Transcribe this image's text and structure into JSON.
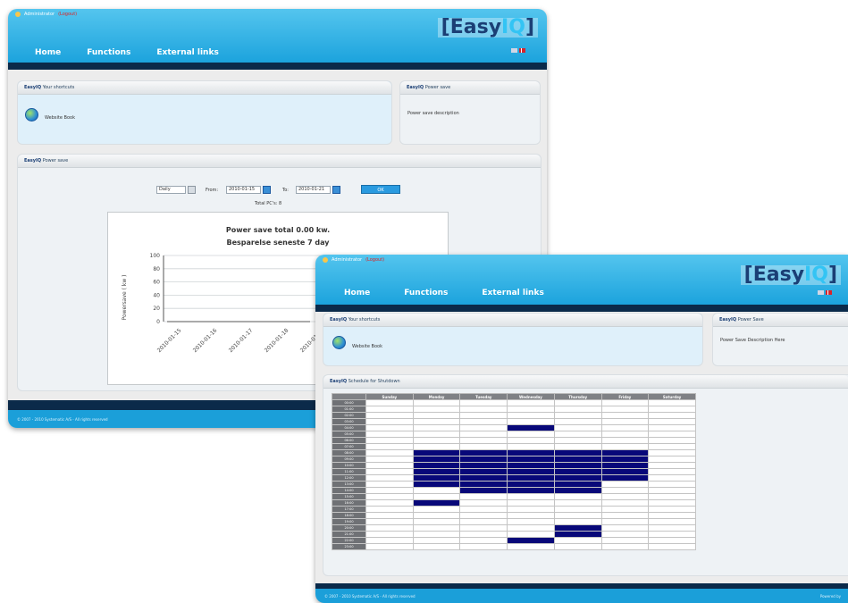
{
  "window1": {
    "header": {
      "user_text": "Administrator",
      "logout_text": "(Logout)",
      "logo_text": "[Easy",
      "logo_highlight": "IQ",
      "logo_end": "]",
      "nav": [
        "Home",
        "Functions",
        "External links"
      ]
    },
    "shortcuts_panel": {
      "brand": "EasyIQ",
      "title": "Your shortcuts",
      "item_label": "Website Book"
    },
    "power_panel": {
      "brand": "EasyIQ",
      "title": "Power save",
      "description": "Power save description"
    },
    "chart_panel": {
      "brand": "EasyIQ",
      "title": "Power save",
      "period_select": "Daily",
      "from_label": "From:",
      "from_date": "2010-01-15",
      "to_label": "To:",
      "to_date": "2010-01-21",
      "ok_label": "OK",
      "total_pcs": "Total PC's: 8"
    },
    "footer_text": "© 2007 - 2010 Systematic A/S - All rights reserved"
  },
  "chart_data": {
    "type": "line",
    "title": "Power save total 0.00 kw.",
    "subtitle": "Besparelse seneste 7 day",
    "ylabel": "Powersave ( kw )",
    "xlabel": "",
    "ylim": [
      0,
      100
    ],
    "yticks": [
      0,
      20,
      40,
      60,
      80,
      100
    ],
    "x": [
      "2010-01-15",
      "2010-01-16",
      "2010-01-17",
      "2010-01-18",
      "2010-01-19"
    ],
    "grid": true,
    "series": [
      {
        "values": [
          0,
          0,
          0,
          0,
          0
        ]
      }
    ]
  },
  "window2": {
    "header": {
      "user_text": "Administrator",
      "logout_text": "(Logout)",
      "logo_text": "[Easy",
      "logo_highlight": "IQ",
      "logo_end": "]",
      "nav": [
        "Home",
        "Functions",
        "External links"
      ]
    },
    "shortcuts_panel": {
      "brand": "EasyIQ",
      "title": "Your shortcuts",
      "item_label": "Website Book"
    },
    "power_panel": {
      "brand": "EasyIQ",
      "title": "Power Save",
      "description": "Power Save Description Here"
    },
    "schedule_panel": {
      "brand": "EasyIQ",
      "title": "Schedule for Shutdown"
    },
    "schedule": {
      "days": [
        "Sunday",
        "Monday",
        "Tuesday",
        "Wednesday",
        "Thursday",
        "Friday",
        "Saturday"
      ],
      "hours": [
        "00:00",
        "01:00",
        "02:00",
        "03:00",
        "04:00",
        "05:00",
        "06:00",
        "07:00",
        "08:00",
        "09:00",
        "10:00",
        "11:00",
        "12:00",
        "13:00",
        "14:00",
        "15:00",
        "16:00",
        "17:00",
        "18:00",
        "19:00",
        "20:00",
        "21:00",
        "22:00",
        "23:00"
      ],
      "active": {
        "4": [
          3
        ],
        "8": [
          1,
          2,
          3,
          4,
          5
        ],
        "9": [
          1,
          2,
          3,
          4,
          5
        ],
        "10": [
          1,
          2,
          3,
          4,
          5
        ],
        "11": [
          1,
          2,
          3,
          4,
          5
        ],
        "12": [
          1,
          2,
          3,
          4,
          5
        ],
        "13": [
          1,
          2,
          3,
          4
        ],
        "14": [
          2,
          3,
          4
        ],
        "16": [
          1
        ],
        "20": [
          4
        ],
        "21": [
          4
        ],
        "22": [
          3
        ]
      }
    },
    "footer_text": "© 2007 - 2010 Systematic A/S - All rights reserved",
    "footer_right": "Powered by"
  }
}
